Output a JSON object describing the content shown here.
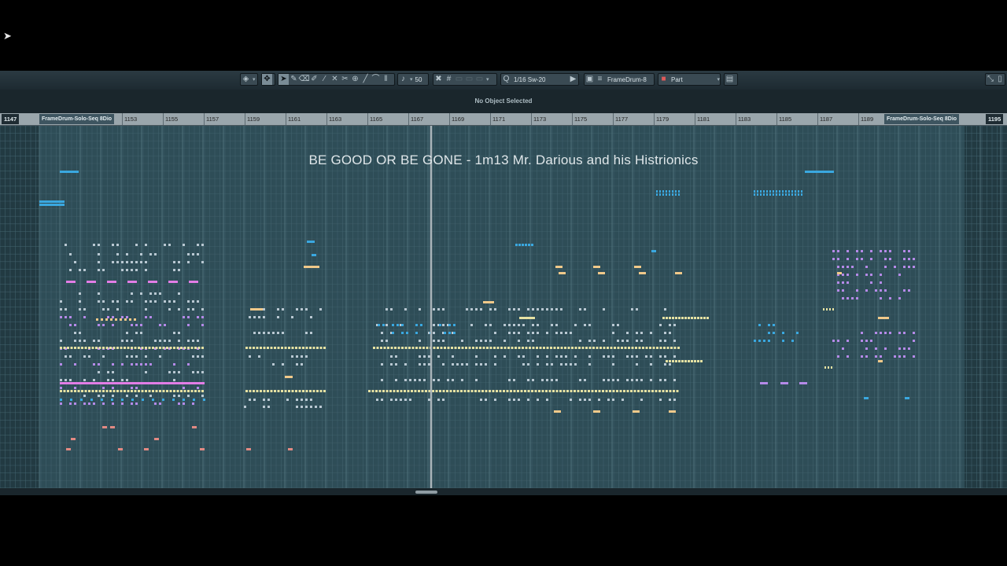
{
  "toolbar": {
    "zoom_value": "50",
    "quantize_value": "1/16 Sw-20",
    "track_name": "FrameDrum-8",
    "view_mode": "Part"
  },
  "status": {
    "text": "No Object Selected"
  },
  "ruler": {
    "bars": [
      "1153",
      "1155",
      "1157",
      "1159",
      "1161",
      "1163",
      "1165",
      "1167",
      "1169",
      "1171",
      "1173",
      "1175",
      "1177",
      "1179",
      "1181",
      "1183",
      "1185",
      "1187",
      "1189"
    ],
    "start_bar": "1147",
    "end_bar": "1195",
    "region_left_name": "FrameDrum-Solo-Seq 8Dio",
    "region_right_name": "FrameDrum-Solo-Seq 8Dio"
  },
  "editor": {
    "title": "BE GOOD OR BE GONE - 1m13 Mr. Darious and his Histrionics"
  },
  "colors": {
    "note_yellow": "#e6e2a3",
    "note_blue": "#3aa8e0",
    "note_purple": "#b58ae8",
    "note_pink": "#e27de6",
    "note_salmon": "#e28a83",
    "note_orange": "#f0c98a",
    "note_grey": "#b9c8d2",
    "background": "#2e4d57",
    "playhead": "#a9b4b9"
  }
}
